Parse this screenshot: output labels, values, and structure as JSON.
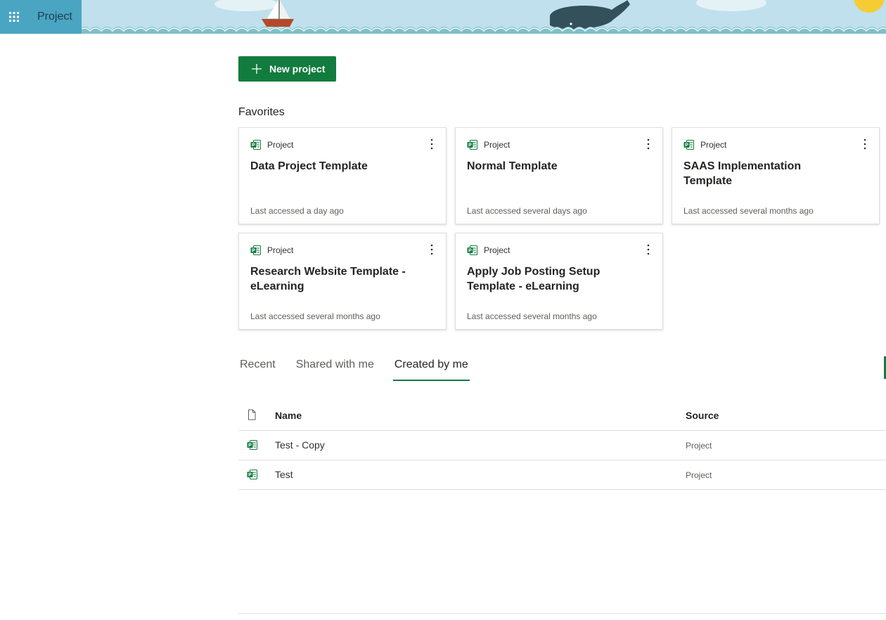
{
  "header": {
    "app_name": "Project",
    "waffle_icon": "app-launcher-icon",
    "colors": {
      "banner_sky": "#bfe0ec",
      "tile": "#4aa5c2",
      "wave": "#7fbfc8"
    }
  },
  "actions": {
    "new_project_label": "New project"
  },
  "favorites": {
    "title": "Favorites",
    "cards": [
      {
        "type": "Project",
        "title": "Data Project Template",
        "meta": "Last accessed a day ago"
      },
      {
        "type": "Project",
        "title": "Normal Template",
        "meta": "Last accessed several days ago"
      },
      {
        "type": "Project",
        "title": "SAAS Implementation Template",
        "meta": "Last accessed several months ago"
      },
      {
        "type": "Project",
        "title": "Research Website Template - eLearning",
        "meta": "Last accessed several months ago"
      },
      {
        "type": "Project",
        "title": "Apply Job Posting Setup Template - eLearning",
        "meta": "Last accessed several months ago"
      }
    ]
  },
  "tabs": [
    {
      "label": "Recent",
      "active": false
    },
    {
      "label": "Shared with me",
      "active": false
    },
    {
      "label": "Created by me",
      "active": true
    }
  ],
  "table": {
    "columns": {
      "name": "Name",
      "source": "Source"
    },
    "rows": [
      {
        "name": "Test - Copy",
        "source": "Project"
      },
      {
        "name": "Test",
        "source": "Project"
      }
    ]
  },
  "theme": {
    "accent": "#127b3e"
  }
}
